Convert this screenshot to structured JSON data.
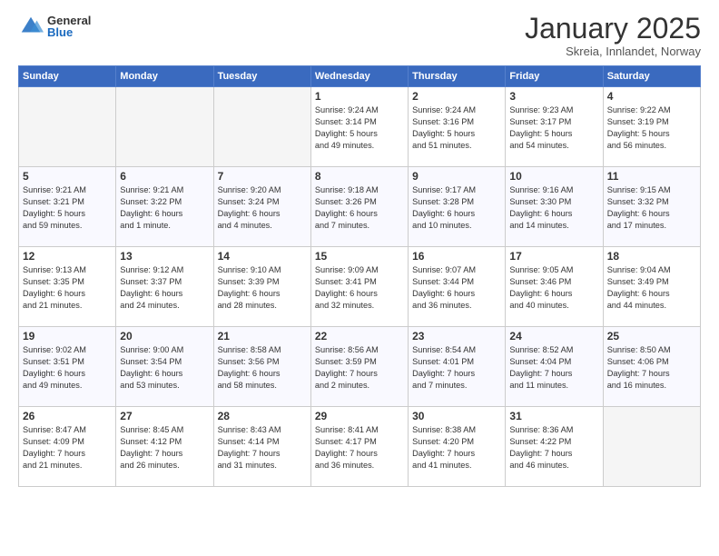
{
  "logo": {
    "general": "General",
    "blue": "Blue"
  },
  "title": "January 2025",
  "subtitle": "Skreia, Innlandet, Norway",
  "days_of_week": [
    "Sunday",
    "Monday",
    "Tuesday",
    "Wednesday",
    "Thursday",
    "Friday",
    "Saturday"
  ],
  "weeks": [
    [
      {
        "day": "",
        "info": ""
      },
      {
        "day": "",
        "info": ""
      },
      {
        "day": "",
        "info": ""
      },
      {
        "day": "1",
        "info": "Sunrise: 9:24 AM\nSunset: 3:14 PM\nDaylight: 5 hours\nand 49 minutes."
      },
      {
        "day": "2",
        "info": "Sunrise: 9:24 AM\nSunset: 3:16 PM\nDaylight: 5 hours\nand 51 minutes."
      },
      {
        "day": "3",
        "info": "Sunrise: 9:23 AM\nSunset: 3:17 PM\nDaylight: 5 hours\nand 54 minutes."
      },
      {
        "day": "4",
        "info": "Sunrise: 9:22 AM\nSunset: 3:19 PM\nDaylight: 5 hours\nand 56 minutes."
      }
    ],
    [
      {
        "day": "5",
        "info": "Sunrise: 9:21 AM\nSunset: 3:21 PM\nDaylight: 5 hours\nand 59 minutes."
      },
      {
        "day": "6",
        "info": "Sunrise: 9:21 AM\nSunset: 3:22 PM\nDaylight: 6 hours\nand 1 minute."
      },
      {
        "day": "7",
        "info": "Sunrise: 9:20 AM\nSunset: 3:24 PM\nDaylight: 6 hours\nand 4 minutes."
      },
      {
        "day": "8",
        "info": "Sunrise: 9:18 AM\nSunset: 3:26 PM\nDaylight: 6 hours\nand 7 minutes."
      },
      {
        "day": "9",
        "info": "Sunrise: 9:17 AM\nSunset: 3:28 PM\nDaylight: 6 hours\nand 10 minutes."
      },
      {
        "day": "10",
        "info": "Sunrise: 9:16 AM\nSunset: 3:30 PM\nDaylight: 6 hours\nand 14 minutes."
      },
      {
        "day": "11",
        "info": "Sunrise: 9:15 AM\nSunset: 3:32 PM\nDaylight: 6 hours\nand 17 minutes."
      }
    ],
    [
      {
        "day": "12",
        "info": "Sunrise: 9:13 AM\nSunset: 3:35 PM\nDaylight: 6 hours\nand 21 minutes."
      },
      {
        "day": "13",
        "info": "Sunrise: 9:12 AM\nSunset: 3:37 PM\nDaylight: 6 hours\nand 24 minutes."
      },
      {
        "day": "14",
        "info": "Sunrise: 9:10 AM\nSunset: 3:39 PM\nDaylight: 6 hours\nand 28 minutes."
      },
      {
        "day": "15",
        "info": "Sunrise: 9:09 AM\nSunset: 3:41 PM\nDaylight: 6 hours\nand 32 minutes."
      },
      {
        "day": "16",
        "info": "Sunrise: 9:07 AM\nSunset: 3:44 PM\nDaylight: 6 hours\nand 36 minutes."
      },
      {
        "day": "17",
        "info": "Sunrise: 9:05 AM\nSunset: 3:46 PM\nDaylight: 6 hours\nand 40 minutes."
      },
      {
        "day": "18",
        "info": "Sunrise: 9:04 AM\nSunset: 3:49 PM\nDaylight: 6 hours\nand 44 minutes."
      }
    ],
    [
      {
        "day": "19",
        "info": "Sunrise: 9:02 AM\nSunset: 3:51 PM\nDaylight: 6 hours\nand 49 minutes."
      },
      {
        "day": "20",
        "info": "Sunrise: 9:00 AM\nSunset: 3:54 PM\nDaylight: 6 hours\nand 53 minutes."
      },
      {
        "day": "21",
        "info": "Sunrise: 8:58 AM\nSunset: 3:56 PM\nDaylight: 6 hours\nand 58 minutes."
      },
      {
        "day": "22",
        "info": "Sunrise: 8:56 AM\nSunset: 3:59 PM\nDaylight: 7 hours\nand 2 minutes."
      },
      {
        "day": "23",
        "info": "Sunrise: 8:54 AM\nSunset: 4:01 PM\nDaylight: 7 hours\nand 7 minutes."
      },
      {
        "day": "24",
        "info": "Sunrise: 8:52 AM\nSunset: 4:04 PM\nDaylight: 7 hours\nand 11 minutes."
      },
      {
        "day": "25",
        "info": "Sunrise: 8:50 AM\nSunset: 4:06 PM\nDaylight: 7 hours\nand 16 minutes."
      }
    ],
    [
      {
        "day": "26",
        "info": "Sunrise: 8:47 AM\nSunset: 4:09 PM\nDaylight: 7 hours\nand 21 minutes."
      },
      {
        "day": "27",
        "info": "Sunrise: 8:45 AM\nSunset: 4:12 PM\nDaylight: 7 hours\nand 26 minutes."
      },
      {
        "day": "28",
        "info": "Sunrise: 8:43 AM\nSunset: 4:14 PM\nDaylight: 7 hours\nand 31 minutes."
      },
      {
        "day": "29",
        "info": "Sunrise: 8:41 AM\nSunset: 4:17 PM\nDaylight: 7 hours\nand 36 minutes."
      },
      {
        "day": "30",
        "info": "Sunrise: 8:38 AM\nSunset: 4:20 PM\nDaylight: 7 hours\nand 41 minutes."
      },
      {
        "day": "31",
        "info": "Sunrise: 8:36 AM\nSunset: 4:22 PM\nDaylight: 7 hours\nand 46 minutes."
      },
      {
        "day": "",
        "info": ""
      }
    ]
  ]
}
